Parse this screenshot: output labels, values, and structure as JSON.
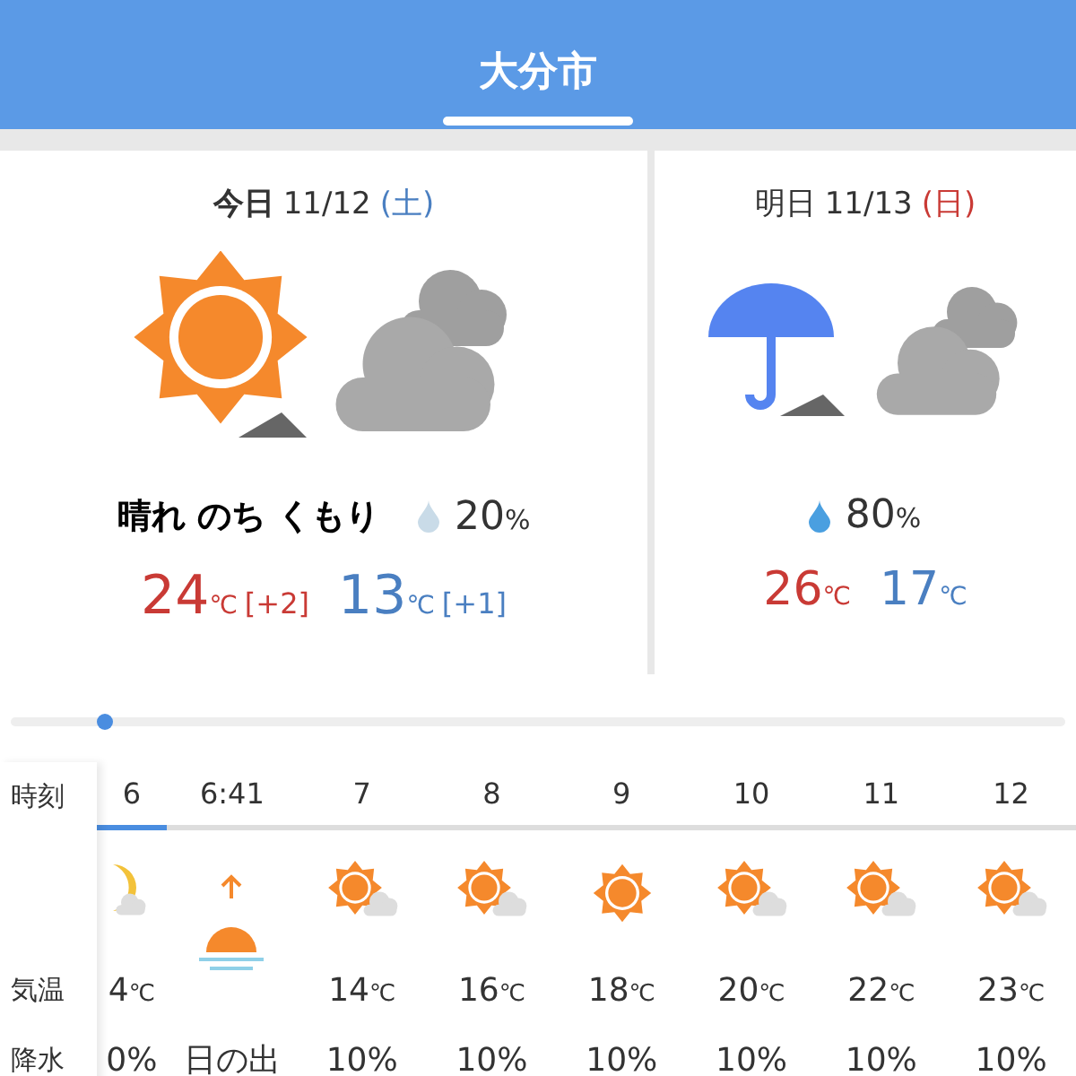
{
  "header": {
    "title": "大分市"
  },
  "days": [
    {
      "label": "今日",
      "date": "11/12",
      "weekday": "(土)",
      "color": "#4a7fc1",
      "kind": "sun-cloud",
      "forecast": "晴れ のち くもり",
      "precip": {
        "value": "20",
        "unit": "%",
        "color": "#c9dbe8"
      },
      "high": {
        "value": "24",
        "unit": "℃",
        "diff": "[+2]"
      },
      "low": {
        "value": "13",
        "unit": "℃",
        "diff": "[+1]"
      }
    },
    {
      "label": "明日",
      "date": "11/13",
      "weekday": "(日)",
      "color": "#c93a35",
      "kind": "umbrella-cloud",
      "precip": {
        "value": "80",
        "unit": "%",
        "color": "#4a9fe0"
      },
      "high": {
        "value": "26",
        "unit": "℃"
      },
      "low": {
        "value": "17",
        "unit": "℃"
      }
    }
  ],
  "hourly": {
    "labels": [
      "時刻",
      "気温",
      "降水"
    ],
    "columns": [
      {
        "time": "6",
        "kind": "moon-cloud",
        "temp": "4",
        "unit": "℃",
        "precip": "0%",
        "selected": true
      },
      {
        "time": "6:41",
        "kind": "sunrise",
        "precip": "日の出",
        "selected": false
      },
      {
        "time": "7",
        "kind": "sun-cloud",
        "temp": "14",
        "unit": "℃",
        "precip": "10%",
        "selected": false
      },
      {
        "time": "8",
        "kind": "sun-cloud",
        "temp": "16",
        "unit": "℃",
        "precip": "10%",
        "selected": false
      },
      {
        "time": "9",
        "kind": "sun",
        "temp": "18",
        "unit": "℃",
        "precip": "10%",
        "selected": false
      },
      {
        "time": "10",
        "kind": "sun-cloud",
        "temp": "20",
        "unit": "℃",
        "precip": "10%",
        "selected": false
      },
      {
        "time": "11",
        "kind": "sun-cloud",
        "temp": "22",
        "unit": "℃",
        "precip": "10%",
        "selected": false
      },
      {
        "time": "12",
        "kind": "sun-cloud",
        "temp": "23",
        "unit": "℃",
        "precip": "10%",
        "selected": false
      }
    ]
  }
}
